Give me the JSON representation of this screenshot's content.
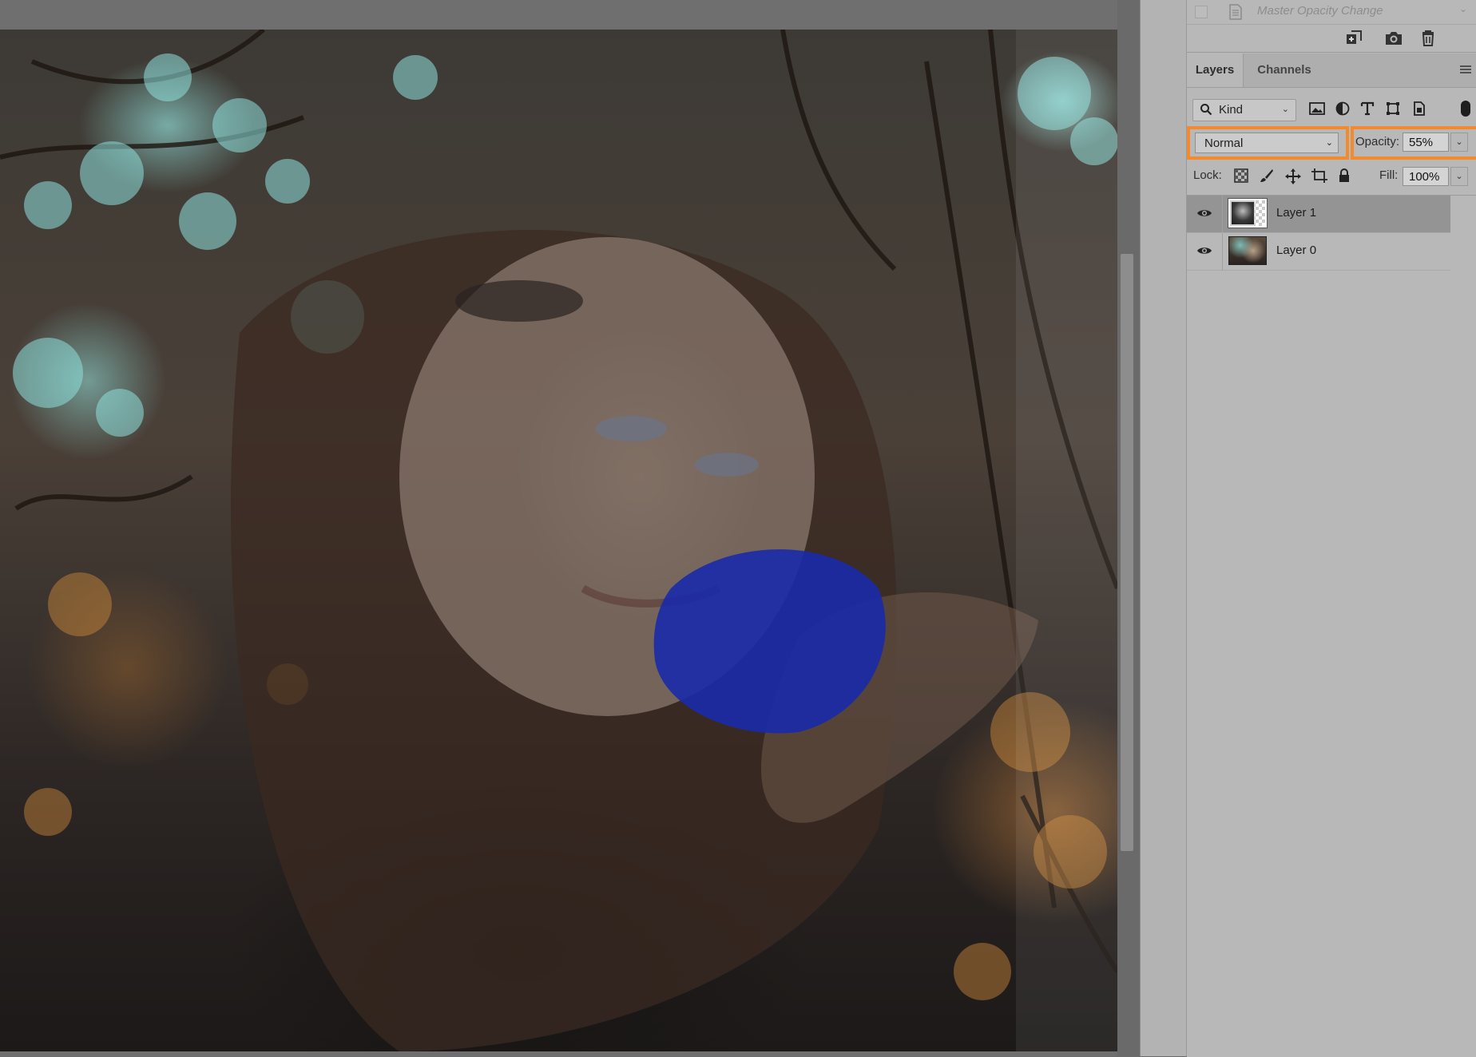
{
  "history": {
    "snapshot_label": "Master Opacity Change",
    "tools": [
      {
        "icon": "new-document-from-state-icon"
      },
      {
        "icon": "camera-snapshot-icon"
      },
      {
        "icon": "trash-icon"
      }
    ]
  },
  "tabs": [
    {
      "label": "Layers",
      "active": true
    },
    {
      "label": "Channels",
      "active": false
    }
  ],
  "filter": {
    "kind_label": "Kind",
    "icons": [
      "image-filter-icon",
      "adjustment-filter-icon",
      "type-filter-icon",
      "shape-filter-icon",
      "smart-object-filter-icon"
    ]
  },
  "blend": {
    "mode": "Normal",
    "opacity_label": "Opacity:",
    "opacity_value": "55%"
  },
  "lock": {
    "label": "Lock:",
    "fill_label": "Fill:",
    "fill_value": "100%"
  },
  "layers": [
    {
      "name": "Layer 1",
      "selected": true,
      "visible": true
    },
    {
      "name": "Layer 0",
      "selected": false,
      "visible": true
    }
  ],
  "colors": {
    "highlight": "#f28a2e",
    "panel_bg": "#b8b8b8",
    "selected_row": "#949494"
  }
}
